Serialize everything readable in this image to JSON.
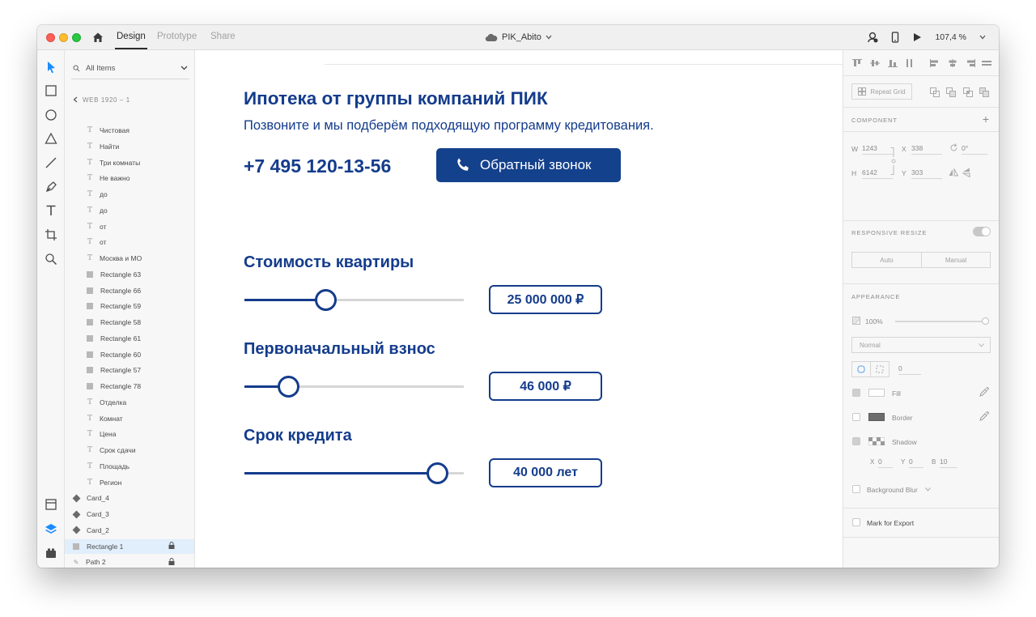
{
  "titlebar": {
    "tabs": [
      {
        "label": "Design",
        "active": true
      },
      {
        "label": "Prototype",
        "active": false
      },
      {
        "label": "Share",
        "active": false
      }
    ],
    "document": "PIK_Abito",
    "zoom": "107,4 %"
  },
  "layers": {
    "filter": "All Items",
    "breadcrumb": "WEB 1920 – 1",
    "items": [
      {
        "icon": "text-icon",
        "label": "Чистовая"
      },
      {
        "icon": "text-icon",
        "label": "Найти"
      },
      {
        "icon": "text-icon",
        "label": "Три комнаты"
      },
      {
        "icon": "text-icon",
        "label": "Не важно"
      },
      {
        "icon": "text-icon",
        "label": "до"
      },
      {
        "icon": "text-icon",
        "label": "до"
      },
      {
        "icon": "text-icon",
        "label": "от"
      },
      {
        "icon": "text-icon",
        "label": "от"
      },
      {
        "icon": "text-icon",
        "label": "Москва и МО"
      },
      {
        "icon": "rectangle-icon",
        "label": "Rectangle 63"
      },
      {
        "icon": "rectangle-icon",
        "label": "Rectangle 66"
      },
      {
        "icon": "rectangle-icon",
        "label": "Rectangle 59"
      },
      {
        "icon": "rectangle-icon",
        "label": "Rectangle 58"
      },
      {
        "icon": "rectangle-icon",
        "label": "Rectangle 61"
      },
      {
        "icon": "rectangle-icon",
        "label": "Rectangle 60"
      },
      {
        "icon": "rectangle-icon",
        "label": "Rectangle 57"
      },
      {
        "icon": "rectangle-icon",
        "label": "Rectangle 78"
      },
      {
        "icon": "text-icon",
        "label": "Отделка"
      },
      {
        "icon": "text-icon",
        "label": "Комнат"
      },
      {
        "icon": "text-icon",
        "label": "Цена"
      },
      {
        "icon": "text-icon",
        "label": "Срок сдачи"
      },
      {
        "icon": "text-icon",
        "label": "Площадь"
      },
      {
        "icon": "text-icon",
        "label": "Регион"
      }
    ],
    "groups": [
      {
        "icon": "symbol-icon",
        "label": "Card_4"
      },
      {
        "icon": "symbol-icon",
        "label": "Card_3"
      },
      {
        "icon": "symbol-icon",
        "label": "Card_2"
      },
      {
        "icon": "rectangle-icon",
        "label": "Rectangle 1",
        "locked": true,
        "selected": true
      },
      {
        "icon": "path-icon",
        "label": "Path 2",
        "locked": true
      }
    ]
  },
  "canvas": {
    "title": "Ипотека от группы компаний ПИК",
    "subtitle": "Позвоните и мы подберём подходящую программу кредитования.",
    "phone": "+7 495 120-13-56",
    "callback_button": "Обратный звонок",
    "brand_color": "#143c8c",
    "sliders": [
      {
        "label": "Стоимость квартиры",
        "value": "25 000 000 ₽",
        "level": 0.37
      },
      {
        "label": "Первоначальный взнос",
        "value": "46 000 ₽",
        "level": 0.2
      },
      {
        "label": "Срок кредита",
        "value": "40 000 лет",
        "level": 0.88
      }
    ]
  },
  "properties": {
    "repeat_grid": "Repeat Grid",
    "component_label": "COMPONENT",
    "w_label": "W",
    "w": "1243",
    "x_label": "X",
    "x": "338",
    "rotation": "0°",
    "h_label": "H",
    "h": "6142",
    "y_label": "Y",
    "y": "303",
    "responsive_label": "RESPONSIVE RESIZE",
    "auto": "Auto",
    "manual": "Manual",
    "appearance_label": "APPEARANCE",
    "opacity": "100%",
    "blend": "Normal",
    "radius": "0",
    "fill": "Fill",
    "border": "Border",
    "shadow": "Shadow",
    "shadow_x_label": "X",
    "shadow_x": "0",
    "shadow_y_label": "Y",
    "shadow_y": "0",
    "shadow_b_label": "B",
    "shadow_b": "10",
    "background_blur": "Background Blur",
    "mark_export": "Mark for Export"
  }
}
